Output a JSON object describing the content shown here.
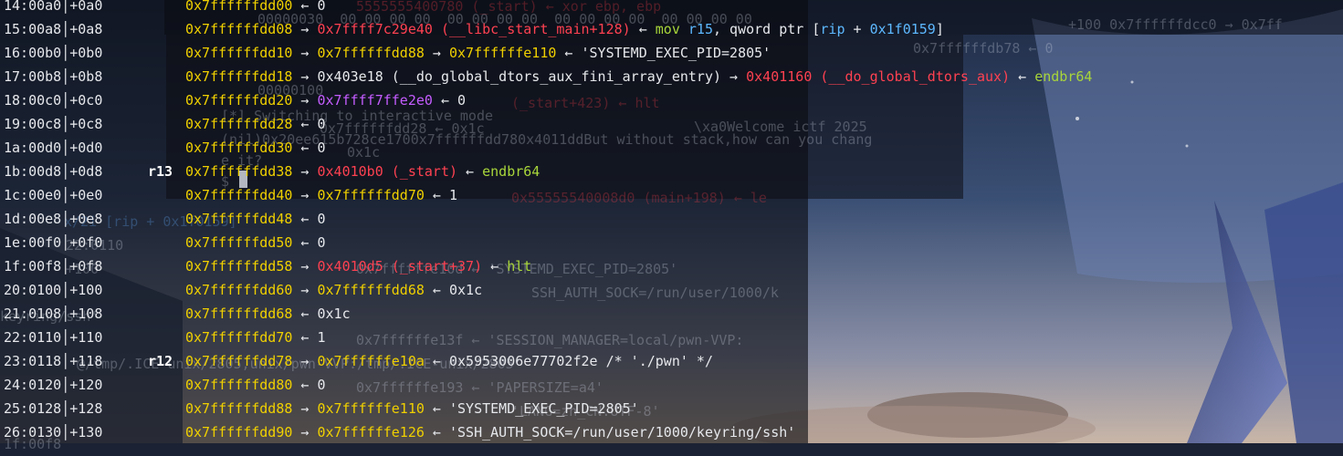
{
  "colors": {
    "address_yellow": "#f0d000",
    "code_red": "#ff4151",
    "instr_green": "#a8d53a",
    "heap_purple": "#c45cff",
    "reg_blue": "#5db8ff"
  },
  "bg_terminal": [
    "00000030  00 00 00 00  00 00 00 00  00 00 00 00  00 00 00 00",
    "00000100",
    "[*] Switching to interactive mode",
    "(nil)0x20ee615b728ce1700x7ffffffdd780x4011ddBut without stack,how can you chang",
    "e it?",
    "$",
    "\\xa0Welcome ictf 2025"
  ],
  "bg_gdb": [
    "5555555400780 (_start) ← xor ebp, ebp",
    "0x7ffffffdb78 ← 0",
    "(_start+423) ← hlt",
    "0x7ffffffdd28 ← 0x1c",
    "0x55555540008d0 (main+198) ← le",
    "0x7ffffffe10d ← 'SYSTEMD_EXEC_PID=2805'",
    "0x1c",
    "SSH_AUTH_SOCK=/run/user/1000/k",
    "keyring/ssh'",
    "0x7ffffffe13f ← 'SESSION_MANAGER=local/pwn-VVP:",
    "@/tmp/.ICE-unix/2805,unix/pwn-VVP:/tmp/.ICE-unix/2805'",
    "0x7ffffffe193 ← 'PAPERSIZE=a4'",
    "'LANG=zh_CN.UTF-8'",
    "x/2i [rip + 0x1f0159]",
    "22:0110",
    "+100 0x7ffffffdcc0 → 0x7ff",
    "+100",
    "1f:00f8"
  ],
  "stack_rows": [
    {
      "off": "14:00a0│+0a0",
      "reg": "",
      "parts": [
        [
          "0x7ffffffdd00",
          "addr"
        ],
        [
          " ← 0",
          "wht"
        ]
      ]
    },
    {
      "off": "15:00a8│+0a8",
      "reg": "",
      "parts": [
        [
          "0x7ffffffdd08",
          "addr"
        ],
        [
          " → ",
          "wht"
        ],
        [
          "0x7ffff7c29e40 (__libc_start_main+128)",
          "red"
        ],
        [
          " ← ",
          "wht"
        ],
        [
          "mov",
          "grn"
        ],
        [
          " r15",
          "blu"
        ],
        [
          ", qword ptr [",
          "wht"
        ],
        [
          "rip",
          "blu"
        ],
        [
          " + ",
          "wht"
        ],
        [
          "0x1f0159",
          "blu"
        ],
        [
          "]",
          "wht"
        ]
      ]
    },
    {
      "off": "16:00b0│+0b0",
      "reg": "",
      "parts": [
        [
          "0x7ffffffdd10",
          "addr"
        ],
        [
          " → ",
          "wht"
        ],
        [
          "0x7ffffffdd88",
          "addr"
        ],
        [
          " → ",
          "wht"
        ],
        [
          "0x7ffffffe110",
          "addr"
        ],
        [
          " ← 'SYSTEMD_EXEC_PID=2805'",
          "wht"
        ]
      ]
    },
    {
      "off": "17:00b8│+0b8",
      "reg": "",
      "parts": [
        [
          "0x7ffffffdd18",
          "addr"
        ],
        [
          " → 0x403e18 (__do_global_dtors_aux_fini_array_entry) → ",
          "wht"
        ],
        [
          "0x401160 (__do_global_dtors_aux)",
          "red"
        ],
        [
          " ← ",
          "wht"
        ],
        [
          "endbr64",
          "grn"
        ]
      ]
    },
    {
      "off": "18:00c0│+0c0",
      "reg": "",
      "parts": [
        [
          "0x7ffffffdd20",
          "addr"
        ],
        [
          " → ",
          "wht"
        ],
        [
          "0x7ffff7ffe2e0",
          "pur"
        ],
        [
          " ← 0",
          "wht"
        ]
      ]
    },
    {
      "off": "19:00c8│+0c8",
      "reg": "",
      "parts": [
        [
          "0x7ffffffdd28",
          "addr"
        ],
        [
          " ← 0",
          "wht"
        ]
      ]
    },
    {
      "off": "1a:00d0│+0d0",
      "reg": "",
      "parts": [
        [
          "0x7ffffffdd30",
          "addr"
        ],
        [
          " ← 0",
          "wht"
        ]
      ]
    },
    {
      "off": "1b:00d8│+0d8",
      "reg": "r13",
      "parts": [
        [
          "0x7ffffffdd38",
          "addr"
        ],
        [
          " → ",
          "wht"
        ],
        [
          "0x4010b0 (_start)",
          "red"
        ],
        [
          " ← ",
          "wht"
        ],
        [
          "endbr64",
          "grn"
        ]
      ]
    },
    {
      "off": "1c:00e0│+0e0",
      "reg": "",
      "parts": [
        [
          "0x7ffffffdd40",
          "addr"
        ],
        [
          " → ",
          "wht"
        ],
        [
          "0x7ffffffdd70",
          "addr"
        ],
        [
          " ← 1",
          "wht"
        ]
      ]
    },
    {
      "off": "1d:00e8│+0e8",
      "reg": "",
      "parts": [
        [
          "0x7ffffffdd48",
          "addr"
        ],
        [
          " ← 0",
          "wht"
        ]
      ]
    },
    {
      "off": "1e:00f0│+0f0",
      "reg": "",
      "parts": [
        [
          "0x7ffffffdd50",
          "addr"
        ],
        [
          " ← 0",
          "wht"
        ]
      ]
    },
    {
      "off": "1f:00f8│+0f8",
      "reg": "",
      "parts": [
        [
          "0x7ffffffdd58",
          "addr"
        ],
        [
          " → ",
          "wht"
        ],
        [
          "0x4010d5 (_start+37)",
          "red"
        ],
        [
          " ← ",
          "wht"
        ],
        [
          "hlt",
          "grn"
        ]
      ]
    },
    {
      "off": "20:0100│+100",
      "reg": "",
      "parts": [
        [
          "0x7ffffffdd60",
          "addr"
        ],
        [
          " → ",
          "wht"
        ],
        [
          "0x7ffffffdd68",
          "addr"
        ],
        [
          " ← 0x1c",
          "wht"
        ]
      ]
    },
    {
      "off": "21:0108│+108",
      "reg": "",
      "parts": [
        [
          "0x7ffffffdd68",
          "addr"
        ],
        [
          " ← 0x1c",
          "wht"
        ]
      ]
    },
    {
      "off": "22:0110│+110",
      "reg": "",
      "parts": [
        [
          "0x7ffffffdd70",
          "addr"
        ],
        [
          " ← 1",
          "wht"
        ]
      ]
    },
    {
      "off": "23:0118│+118",
      "reg": "r12",
      "parts": [
        [
          "0x7ffffffdd78",
          "addr"
        ],
        [
          " → ",
          "wht"
        ],
        [
          "0x7ffffffe10a",
          "addr"
        ],
        [
          " ← 0x5953006e77702f2e /* './pwn' */",
          "wht"
        ]
      ]
    },
    {
      "off": "24:0120│+120",
      "reg": "",
      "parts": [
        [
          "0x7ffffffdd80",
          "addr"
        ],
        [
          " ← 0",
          "wht"
        ]
      ]
    },
    {
      "off": "25:0128│+128",
      "reg": "",
      "parts": [
        [
          "0x7ffffffdd88",
          "addr"
        ],
        [
          " → ",
          "wht"
        ],
        [
          "0x7ffffffe110",
          "addr"
        ],
        [
          " ← 'SYSTEMD_EXEC_PID=2805'",
          "wht"
        ]
      ]
    },
    {
      "off": "26:0130│+130",
      "reg": "",
      "parts": [
        [
          "0x7ffffffdd90",
          "addr"
        ],
        [
          " → ",
          "wht"
        ],
        [
          "0x7ffffffe126",
          "addr"
        ],
        [
          " ← 'SSH_AUTH_SOCK=/run/user/1000/keyring/ssh'",
          "wht"
        ]
      ]
    }
  ]
}
